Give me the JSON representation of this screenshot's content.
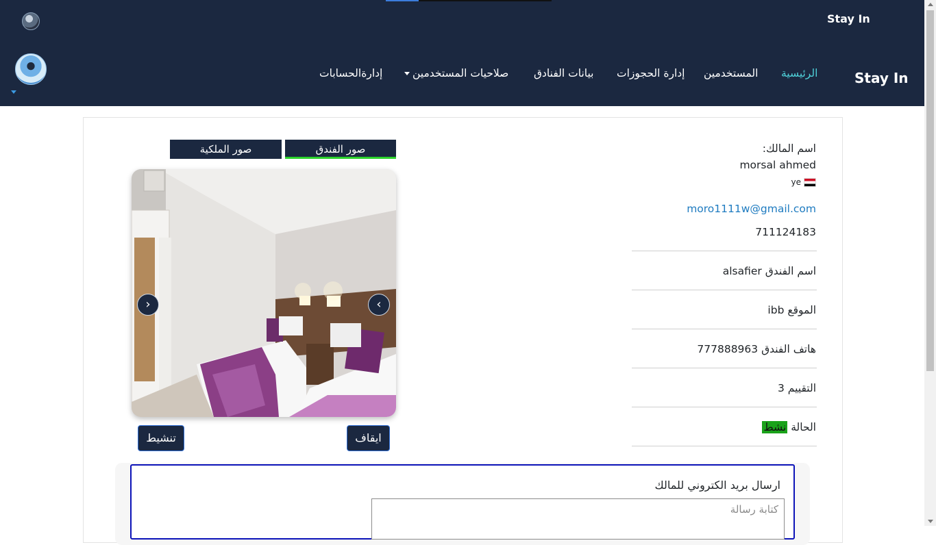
{
  "header": {
    "brand_top": "Stay In",
    "brand_main": "Stay In",
    "nav": {
      "home": "الرئيسية",
      "users": "المستخدمين",
      "bookings": "إدارة الحجوزات",
      "hotels": "بيانات الفنادق",
      "permissions": "صلاحيات المستخدمين",
      "accounts": "إدارةالحسابات"
    },
    "colors": {
      "bar": "#1b2840",
      "active": "#4fd1d9"
    }
  },
  "owner": {
    "label": "اسم المالك:",
    "name": "morsal ahmed",
    "country": "ye",
    "email": "moro1111w@gmail.com",
    "phone": "711124183"
  },
  "hotel": {
    "name_label": "اسم الفندق",
    "name": "alsafier",
    "location_label": "الموقع",
    "location": "ibb",
    "phone_label": "هاتف الفندق",
    "phone": "777888963",
    "rating_label": "التقييم",
    "rating": "3",
    "status_label": "الحالة",
    "status": "نشط",
    "status_color": "#1aa21a"
  },
  "gallery": {
    "tab_hotel": "صور الفندق",
    "tab_royal": "صور الملكية",
    "prev_icon": "chevron-left-icon",
    "next_icon": "chevron-right-icon"
  },
  "actions": {
    "stop": "ايقاف",
    "activate": "تنشيط"
  },
  "mail": {
    "title": "ارسال بريد الكتروني للمالك",
    "placeholder": "كتابة رسالة",
    "border_color": "#0b12b8"
  }
}
